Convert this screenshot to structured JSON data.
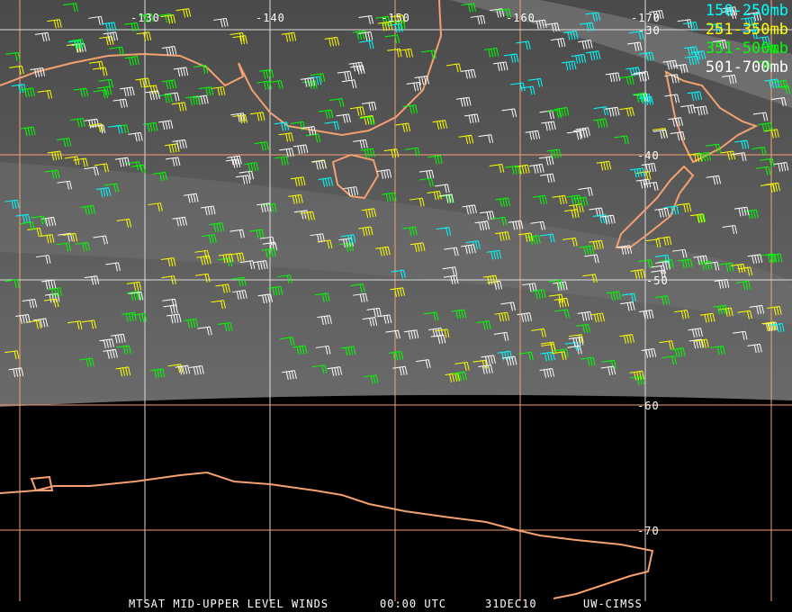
{
  "longitude_labels": [
    "-130",
    "-140",
    "-150",
    "-160",
    "-170"
  ],
  "latitude_labels": [
    "-30",
    "-40",
    "-50",
    "-60",
    "-70"
  ],
  "legend": [
    {
      "label": "150-250mb",
      "color": "#00ffff"
    },
    {
      "label": "251-350mb",
      "color": "#ffff00"
    },
    {
      "label": "351-500mb",
      "color": "#00ff00"
    },
    {
      "label": "501-700mb",
      "color": "#ffffff"
    }
  ],
  "caption": {
    "product": "MTSAT MID-UPPER LEVEL WINDS",
    "time": "00:00 UTC",
    "date": "31DEC10",
    "source": "UW-CIMSS"
  },
  "colors": {
    "grid_orange": "#f4a070",
    "coast": "#f4a070",
    "grid_white": "#ffffff"
  }
}
